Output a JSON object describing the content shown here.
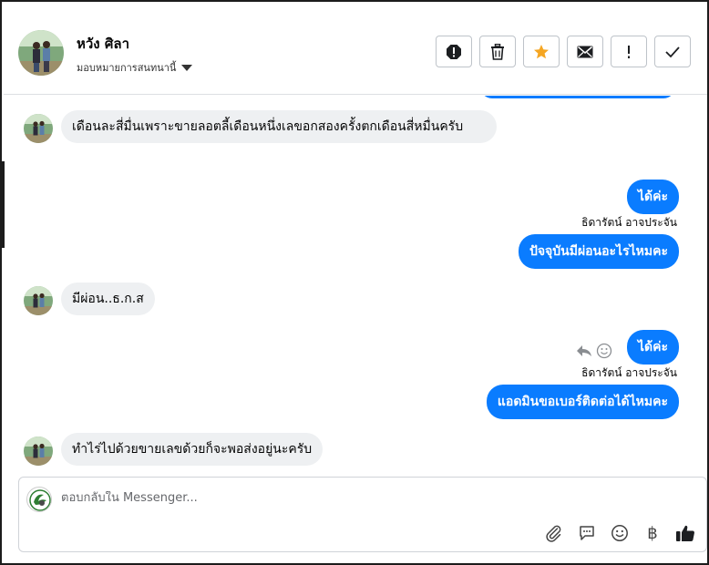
{
  "header": {
    "contact_name": "หวัง ศิลา",
    "assign_label": "มอบหมายการสนทนานี้",
    "actions": [
      "report-icon",
      "trash-icon",
      "star-icon",
      "mail-icon",
      "exclamation-icon",
      "check-icon"
    ]
  },
  "messages": [
    {
      "direction": "incoming",
      "text": "เดือนละสี่มื่นเพราะขายลอตลี้เดือนหนึ่งเลขอกสองครั้งตกเดือนสี่หมื่นครับ"
    },
    {
      "direction": "outgoing",
      "text": "ได้ค่ะ"
    },
    {
      "direction": "outgoing",
      "sender": "ธิดารัตน์ อาจประจัน",
      "text": "ปัจจุบันมีผ่อนอะไรไหมคะ"
    },
    {
      "direction": "incoming",
      "text": "มีผ่อน..ธ.ก.ส"
    },
    {
      "direction": "outgoing",
      "text": "ได้ค่ะ"
    },
    {
      "direction": "outgoing",
      "sender": "ธิดารัตน์ อาจประจัน",
      "text": "แอดมินขอเบอร์ติดต่อได้ไหมคะ"
    },
    {
      "direction": "incoming",
      "text": "ทำไร่ไปด้วยขายเลขด้วยก็จะพอส่งอยู่นะครับ"
    }
  ],
  "composer": {
    "placeholder": "ตอบกลับใน Messenger...",
    "tools": [
      "paperclip-icon",
      "saved-reply-icon",
      "emoji-icon",
      "baht-icon",
      "thumbs-up-icon"
    ],
    "baht_symbol": "฿"
  },
  "colors": {
    "outgoing_bubble": "#0a7cff",
    "incoming_bubble": "#eef0f2",
    "star": "#f5a623"
  }
}
